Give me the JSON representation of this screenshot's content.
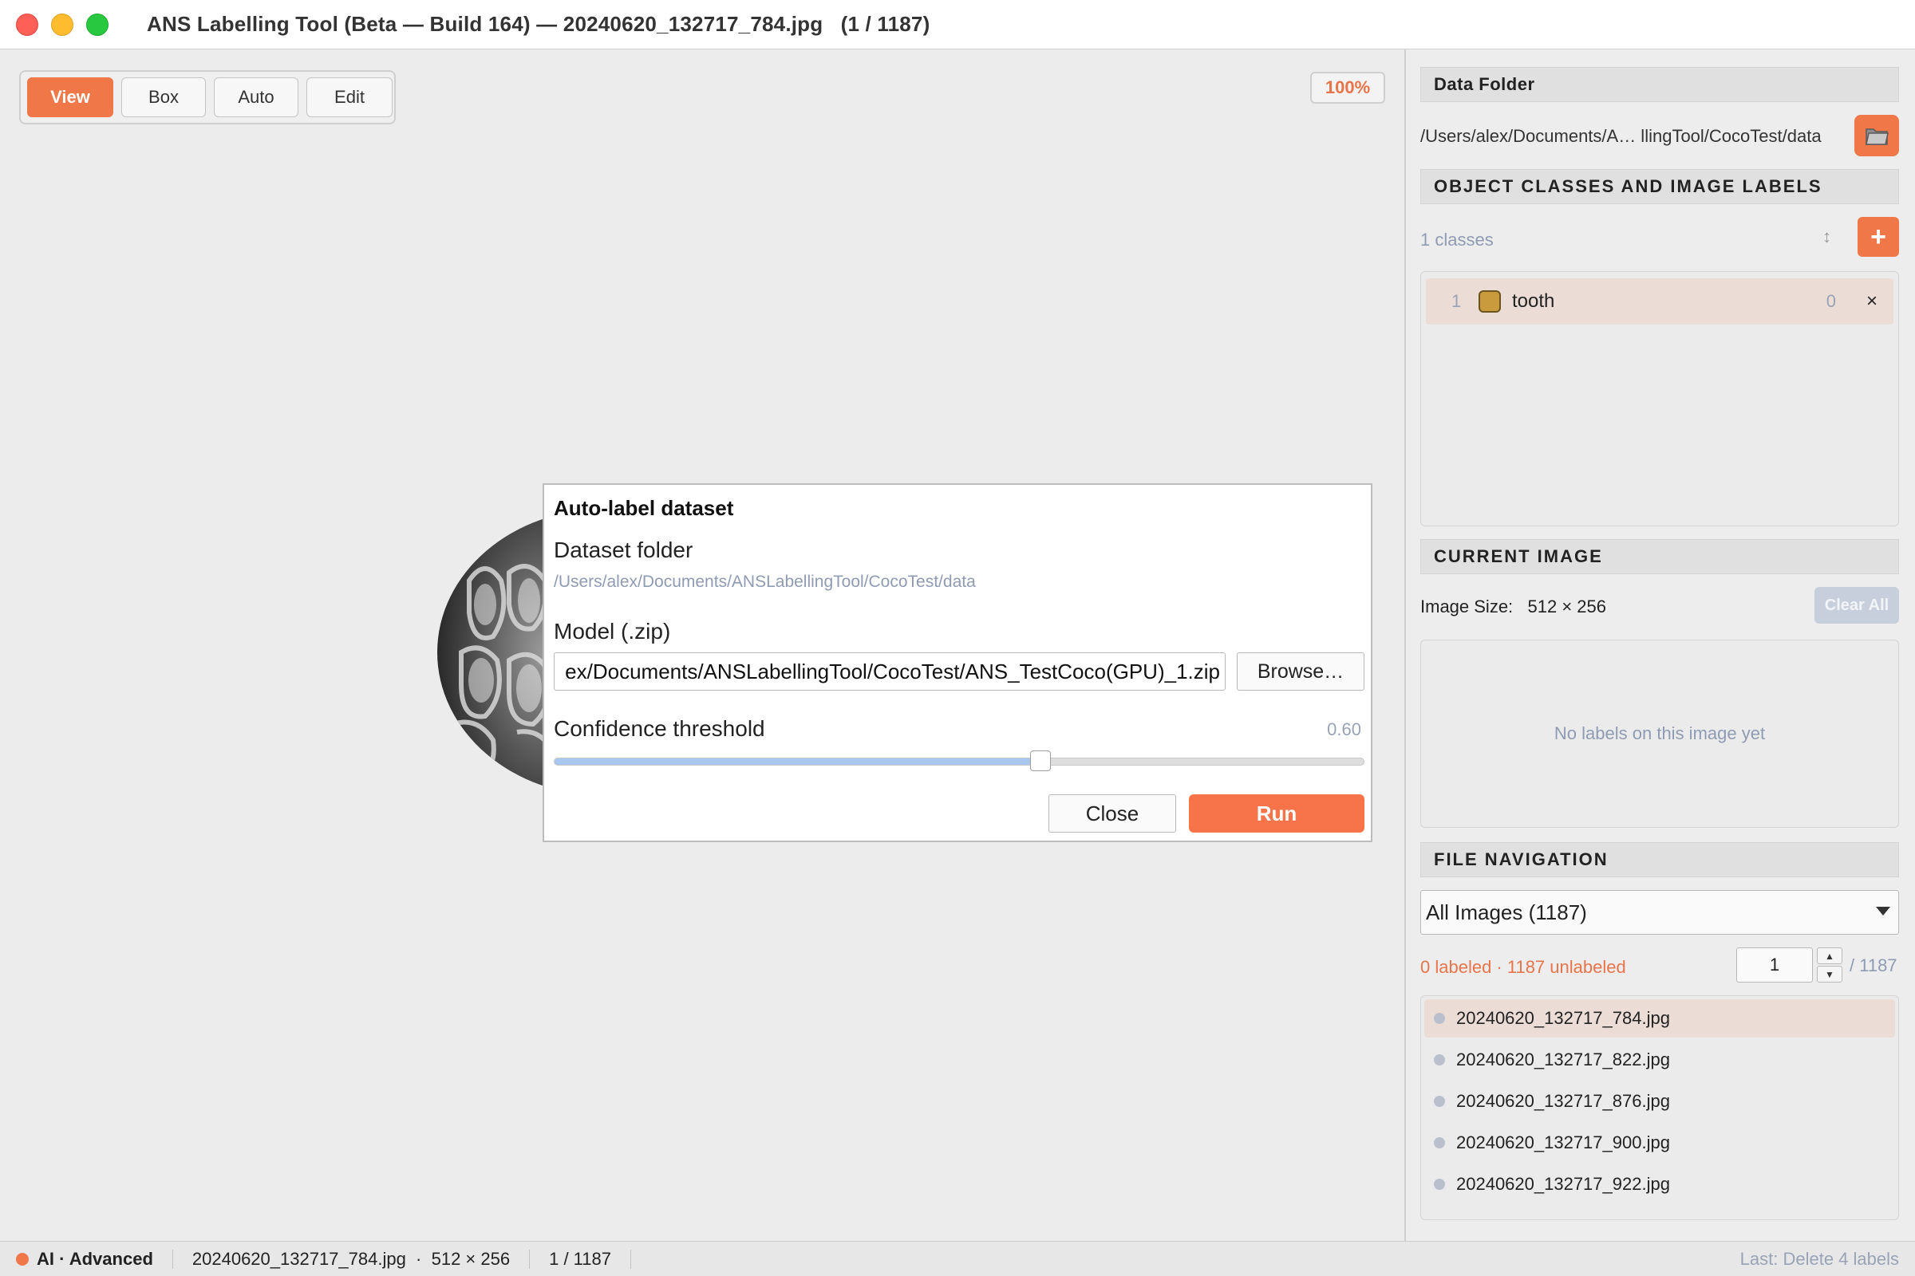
{
  "window": {
    "title": "ANS Labelling Tool (Beta — Build 164) — 20240620_132717_784.jpg   (1 / 1187)"
  },
  "toolbar": {
    "modes": [
      {
        "label": "View",
        "active": true
      },
      {
        "label": "Box",
        "active": false
      },
      {
        "label": "Auto",
        "active": false
      },
      {
        "label": "Edit",
        "active": false
      }
    ],
    "zoom": "100%"
  },
  "dialog": {
    "title": "Auto-label dataset",
    "dataset_label": "Dataset folder",
    "dataset_path": "/Users/alex/Documents/ANSLabellingTool/CocoTest/data",
    "model_label": "Model (.zip)",
    "model_value": "ex/Documents/ANSLabellingTool/CocoTest/ANS_TestCoco(GPU)_1.zip",
    "browse_label": "Browse…",
    "confidence_label": "Confidence threshold",
    "confidence_value": "0.60",
    "confidence_level": 0.6,
    "close_label": "Close",
    "run_label": "Run"
  },
  "panel": {
    "data_folder": {
      "heading": "Data Folder",
      "path": "/Users/alex/Documents/A… llingTool/CocoTest/data",
      "button_icon": "folder-icon"
    },
    "classes": {
      "heading": "OBJECT CLASSES AND IMAGE LABELS",
      "count_text": "1 classes",
      "sort_icon": "↕",
      "add_label": "+",
      "items": [
        {
          "index": "1",
          "name": "tooth",
          "count": "0",
          "color": "#c99b3c",
          "delete": "×"
        }
      ]
    },
    "current_image": {
      "heading": "CURRENT IMAGE",
      "size_label": "Image Size:",
      "size_value": "512 × 256",
      "clear_label": "Clear All",
      "empty_text": "No labels on this image yet"
    },
    "file_nav": {
      "heading": "FILE NAVIGATION",
      "filter": "All Images (1187)",
      "stats": "0 labeled · 1187 unlabeled",
      "page": "1",
      "page_total": "/ 1187",
      "files": [
        {
          "name": "20240620_132717_784.jpg",
          "selected": true
        },
        {
          "name": "20240620_132717_822.jpg",
          "selected": false
        },
        {
          "name": "20240620_132717_876.jpg",
          "selected": false
        },
        {
          "name": "20240620_132717_900.jpg",
          "selected": false
        },
        {
          "name": "20240620_132717_922.jpg",
          "selected": false
        }
      ]
    }
  },
  "status": {
    "mode": "AI · Advanced",
    "file": "20240620_132717_784.jpg  ·  512 × 256",
    "position": "1 / 1187",
    "last_action": "Last: Delete 4 labels"
  },
  "colors": {
    "accent": "#ef7748",
    "selected_row": "#ecdcd6",
    "muted_text": "#8f9bb3"
  }
}
